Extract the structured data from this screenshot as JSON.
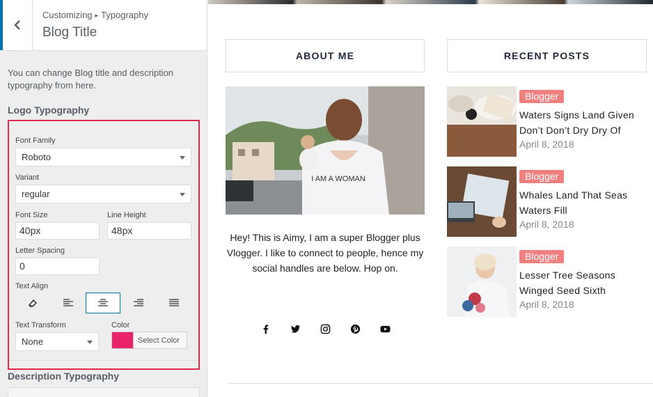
{
  "sidebar": {
    "breadcrumb": {
      "parent": "Customizing",
      "separator": "▸",
      "current": "Typography"
    },
    "title": "Blog Title",
    "description": "You can change Blog title and description typography from here.",
    "logo_section_title": "Logo Typography",
    "font_family": {
      "label": "Font Family",
      "value": "Roboto"
    },
    "variant": {
      "label": "Variant",
      "value": "regular"
    },
    "font_size": {
      "label": "Font Size",
      "value": "40px"
    },
    "line_height": {
      "label": "Line Height",
      "value": "48px"
    },
    "letter_spacing": {
      "label": "Letter Spacing",
      "value": "0"
    },
    "text_align": {
      "label": "Text Align",
      "active": "center",
      "options": [
        "clear",
        "left",
        "center",
        "right",
        "justify"
      ]
    },
    "text_transform": {
      "label": "Text Transform",
      "value": "None"
    },
    "color": {
      "label": "Color",
      "button": "Select Color",
      "value": "#e8236b"
    },
    "description_section_title": "Description Typography",
    "accent": "#0073aa",
    "highlight": "#e02a4d"
  },
  "preview": {
    "about": {
      "heading": "ABOUT ME",
      "image_text": "I AM A WOMAN",
      "text": "Hey! This is Aimy, I am a super Blogger plus Vlogger. I like to connect to people, hence my social handles are below. Hop on.",
      "socials": [
        "facebook-icon",
        "twitter-icon",
        "instagram-icon",
        "pinterest-icon",
        "youtube-icon"
      ]
    },
    "recent": {
      "heading": "RECENT POSTS",
      "badge_color": "#f08080",
      "posts": [
        {
          "badge": "Blogger",
          "title": "Waters Signs Land Given Don’t Don’t Dry Dry Of",
          "date": "April 8, 2018"
        },
        {
          "badge": "Blogger",
          "title": "Whales Land That Seas Waters Fill",
          "date": "April 8, 2018"
        },
        {
          "badge": "Blogger",
          "title": "Lesser Tree Seasons Winged Seed Sixth",
          "date": "April 8, 2018"
        }
      ]
    }
  }
}
